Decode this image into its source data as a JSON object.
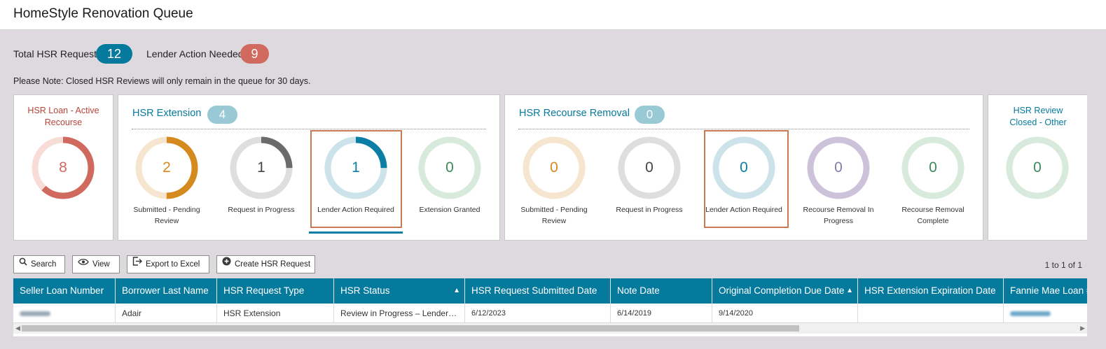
{
  "header": {
    "title": "HomeStyle Renovation Queue"
  },
  "stats": {
    "total_label": "Total HSR Requests",
    "total_count": "12",
    "lender_label": "Lender Action Needed",
    "lender_count": "9"
  },
  "note": "Please Note: Closed HSR Reviews will only remain in the queue for 30 days.",
  "panels": {
    "active_recourse": {
      "title_line1": "HSR Loan - Active",
      "title_line2": "Recourse",
      "value": "8",
      "fraction": 0.62
    },
    "extension": {
      "title": "HSR Extension",
      "count": "4",
      "items": [
        {
          "line1": "Submitted - Pending",
          "line2": "Review",
          "value": "2",
          "fraction": 0.5
        },
        {
          "line1": "Request in Progress",
          "line2": "",
          "value": "1",
          "fraction": 0.25
        },
        {
          "line1": "Lender Action Required",
          "line2": "",
          "value": "1",
          "fraction": 0.25
        },
        {
          "line1": "Extension Granted",
          "line2": "",
          "value": "0",
          "fraction": 0
        }
      ]
    },
    "recourse_removal": {
      "title": "HSR Recourse Removal",
      "count": "0",
      "items": [
        {
          "line1": "Submitted - Pending",
          "line2": "Review",
          "value": "0",
          "fraction": 0
        },
        {
          "line1": "Request in Progress",
          "line2": "",
          "value": "0",
          "fraction": 0
        },
        {
          "line1": "Lender Action Required",
          "line2": "",
          "value": "0",
          "fraction": 0
        },
        {
          "line1": "Recourse Removal In",
          "line2": "Progress",
          "value": "0",
          "fraction": 0
        },
        {
          "line1": "Recourse Removal",
          "line2": "Complete",
          "value": "0",
          "fraction": 0
        }
      ]
    },
    "review_closed": {
      "title_line1": "HSR Review",
      "title_line2": "Closed - Other",
      "value": "0",
      "fraction": 0
    }
  },
  "toolbar": {
    "search": "Search",
    "view": "View",
    "export": "Export to Excel",
    "create": "Create HSR Request",
    "pager": "1 to 1 of 1"
  },
  "table": {
    "columns": [
      "Seller Loan Number",
      "Borrower Last Name",
      "HSR Request Type",
      "HSR Status",
      "HSR Request Submitted Date",
      "Note Date",
      "Original Completion Due Date",
      "HSR Extension Expiration Date",
      "Fannie Mae Loan #"
    ],
    "rows": [
      [
        "",
        "Adair",
        "HSR Extension",
        "Review in Progress – Lender…",
        "6/12/2023",
        "6/14/2019",
        "9/14/2020",
        "",
        ""
      ]
    ]
  },
  "colors": {
    "brand_blue": "#067a9c",
    "alert_red": "#d06a5e",
    "highlight_border": "#c97a52",
    "pending_orange": "#d48a1e",
    "progress_gray": "#6b6b6b",
    "action_teal": "#0a7ea4",
    "granted_green": "#3a8a5a",
    "recourse_red": "#d06a5e",
    "removal_purple": "#8a7aa8"
  }
}
